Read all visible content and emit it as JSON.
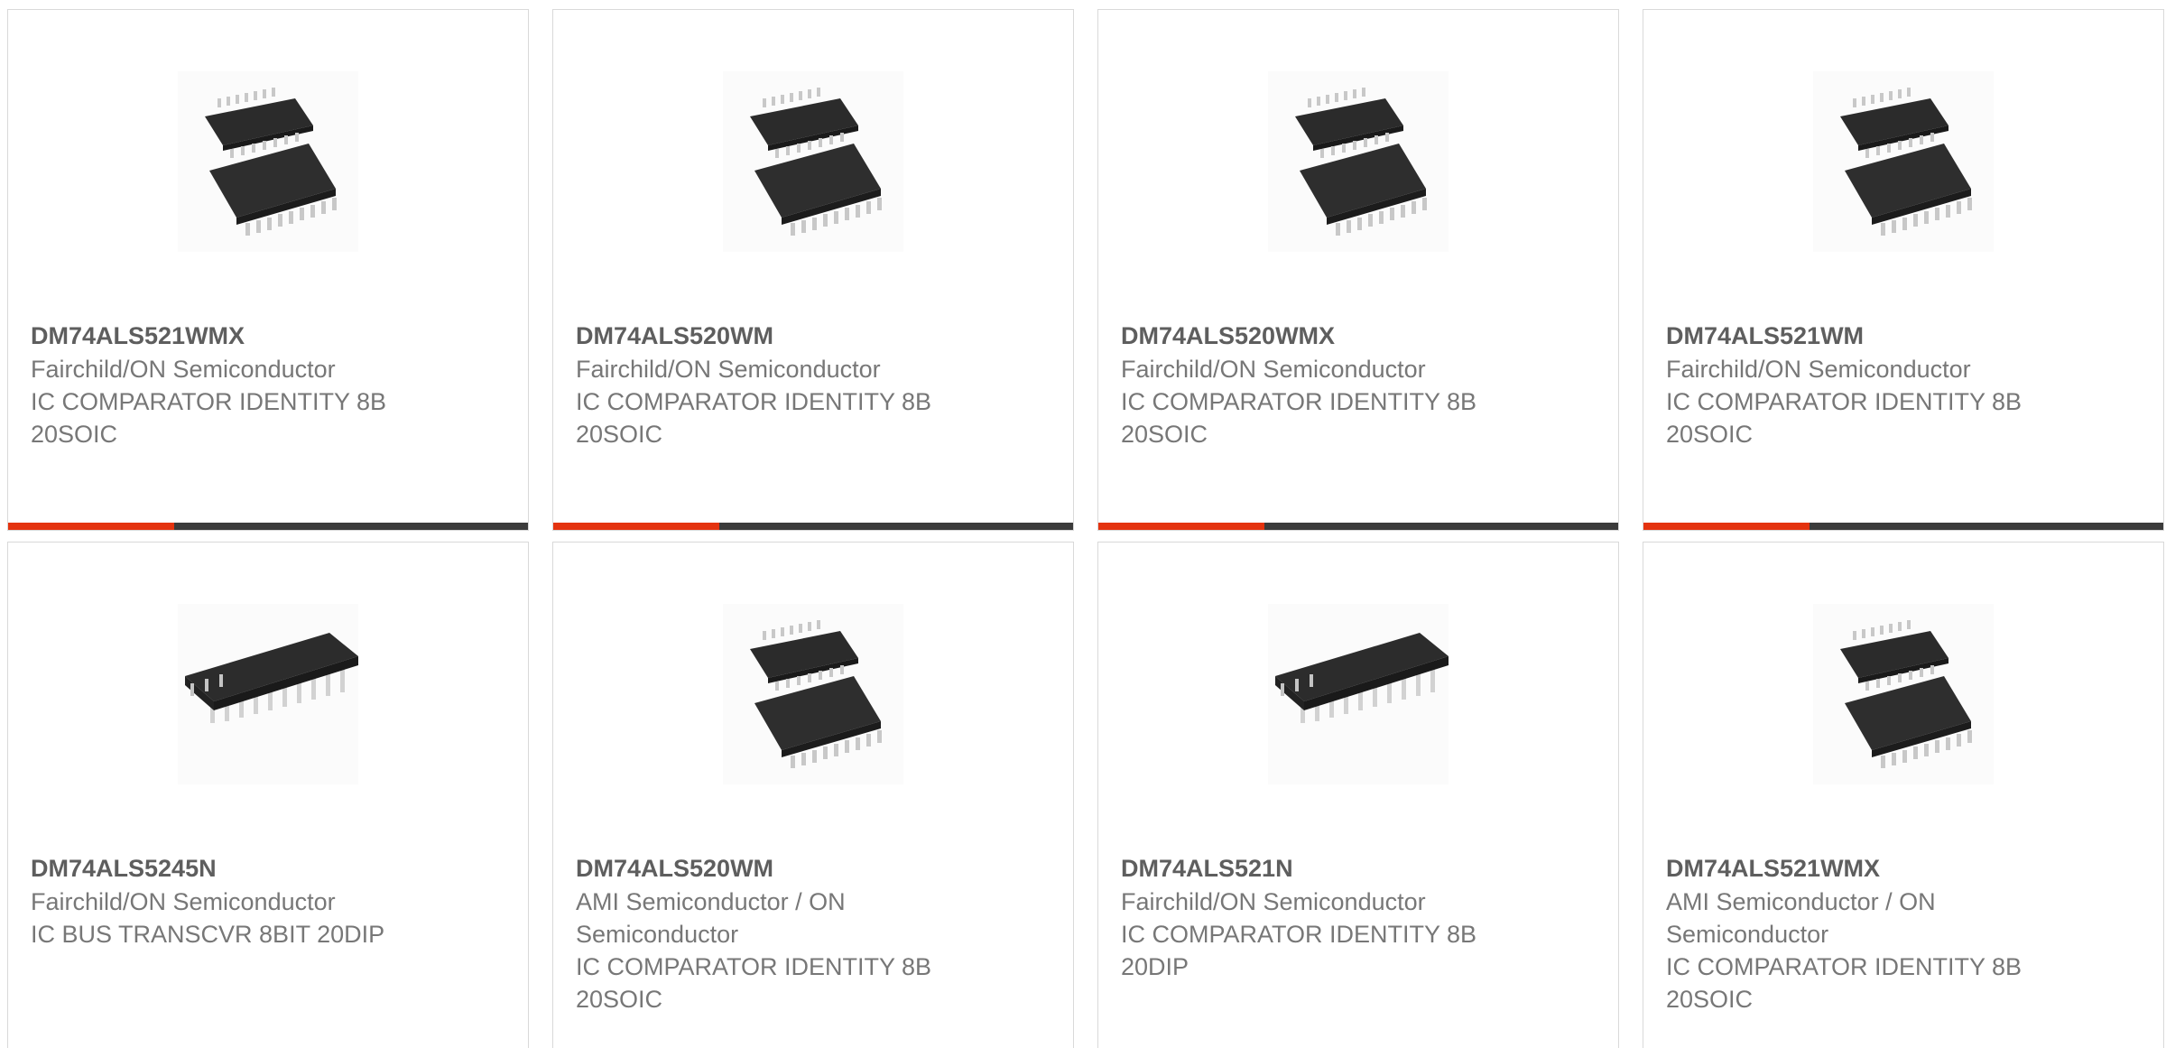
{
  "products": [
    {
      "part": "DM74ALS521WMX",
      "maker": "Fairchild/ON Semiconductor",
      "desc_lines": [
        "IC COMPARATOR IDENTITY 8B",
        "20SOIC"
      ],
      "image_icon": "soic-chip-icon",
      "progress": 0.32
    },
    {
      "part": "DM74ALS520WM",
      "maker": "Fairchild/ON Semiconductor",
      "desc_lines": [
        "IC COMPARATOR IDENTITY 8B",
        "20SOIC"
      ],
      "image_icon": "soic-chip-icon",
      "progress": 0.32
    },
    {
      "part": "DM74ALS520WMX",
      "maker": "Fairchild/ON Semiconductor",
      "desc_lines": [
        "IC COMPARATOR IDENTITY 8B",
        "20SOIC"
      ],
      "image_icon": "soic-chip-icon",
      "progress": 0.32
    },
    {
      "part": "DM74ALS521WM",
      "maker": "Fairchild/ON Semiconductor",
      "desc_lines": [
        "IC COMPARATOR IDENTITY 8B",
        "20SOIC"
      ],
      "image_icon": "soic-chip-icon",
      "progress": 0.32
    },
    {
      "part": "DM74ALS5245N",
      "maker": "Fairchild/ON Semiconductor",
      "desc_lines": [
        "IC BUS TRANSCVR 8BIT 20DIP"
      ],
      "image_icon": "dip-chip-icon"
    },
    {
      "part": "DM74ALS520WM",
      "maker_lines": [
        "AMI Semiconductor / ON",
        "Semiconductor"
      ],
      "desc_lines": [
        "IC COMPARATOR IDENTITY 8B",
        "20SOIC"
      ],
      "image_icon": "soic-chip-icon"
    },
    {
      "part": "DM74ALS521N",
      "maker": "Fairchild/ON Semiconductor",
      "desc_lines": [
        "IC COMPARATOR IDENTITY 8B",
        "20DIP"
      ],
      "image_icon": "dip-chip-icon"
    },
    {
      "part": "DM74ALS521WMX",
      "maker_lines": [
        "AMI Semiconductor / ON",
        "Semiconductor"
      ],
      "desc_lines": [
        "IC COMPARATOR IDENTITY 8B",
        "20SOIC"
      ],
      "image_icon": "soic-chip-icon"
    }
  ],
  "colors": {
    "accent": "#e4330f",
    "bar_dark": "#3b3b3b",
    "text": "#777777",
    "part_text": "#5e5e5e",
    "border": "#d9d9d9"
  }
}
